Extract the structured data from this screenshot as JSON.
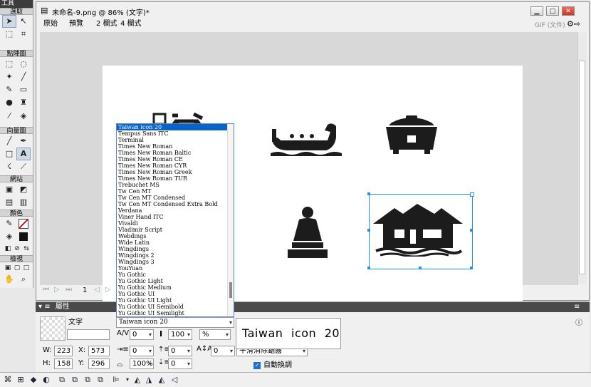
{
  "tools_panel": {
    "title": "工具",
    "sections": [
      "選取",
      "點陣圖",
      "向量圖",
      "網站",
      "顏色",
      "檢視"
    ]
  },
  "document": {
    "title": "未命名-9.png @ 86% (文字)*",
    "tabs": [
      "原始",
      "預覽",
      "2 欄式",
      "4 欄式"
    ],
    "export_format": "GIF (文件)",
    "page_number": "1"
  },
  "font_list": {
    "items": [
      "Taiwan icon 20",
      "Tempus Sans ITC",
      "Terminal",
      "Times New Roman",
      "Times New Roman Baltic",
      "Times New Roman CE",
      "Times New Roman CYR",
      "Times New Roman Greek",
      "Times New Roman TUR",
      "Trebuchet MS",
      "Tw Cen MT",
      "Tw Cen MT Condensed",
      "Tw Cen MT Condensed Extra Bold",
      "Verdana",
      "Viner Hand ITC",
      "Vivaldi",
      "Vladimir Script",
      "Webdings",
      "Wide Latin",
      "Wingdings",
      "Wingdings 2",
      "Wingdings 3",
      "YouYuan",
      "Yu Gothic",
      "Yu Gothic Light",
      "Yu Gothic Medium",
      "Yu Gothic UI",
      "Yu Gothic UI Light",
      "Yu Gothic UI Semibold",
      "Yu Gothic UI Semilight"
    ],
    "selected_index": 0
  },
  "properties": {
    "title": "屬性",
    "object_type": "文字",
    "font": "Taiwan icon 20",
    "font_preview": "Taiwan icon 20",
    "kerning": "0",
    "font_size": "100",
    "leading": "%",
    "indent": "0",
    "space_before": "0",
    "baseline_shift": "0",
    "paragraph_spacing": "0",
    "horizontal_scale": "100%",
    "space_after": "0",
    "w": "223",
    "x": "573",
    "h": "158",
    "y": "296",
    "antialias_option": "平滑消除鋸齒",
    "auto_kern_label": "自動換調",
    "auto_kern_checked": true
  },
  "colors": {
    "selection_handle": "#1e90ff",
    "list_highlight": "#0a64c8",
    "icon_fill": "#1c1c1c"
  }
}
